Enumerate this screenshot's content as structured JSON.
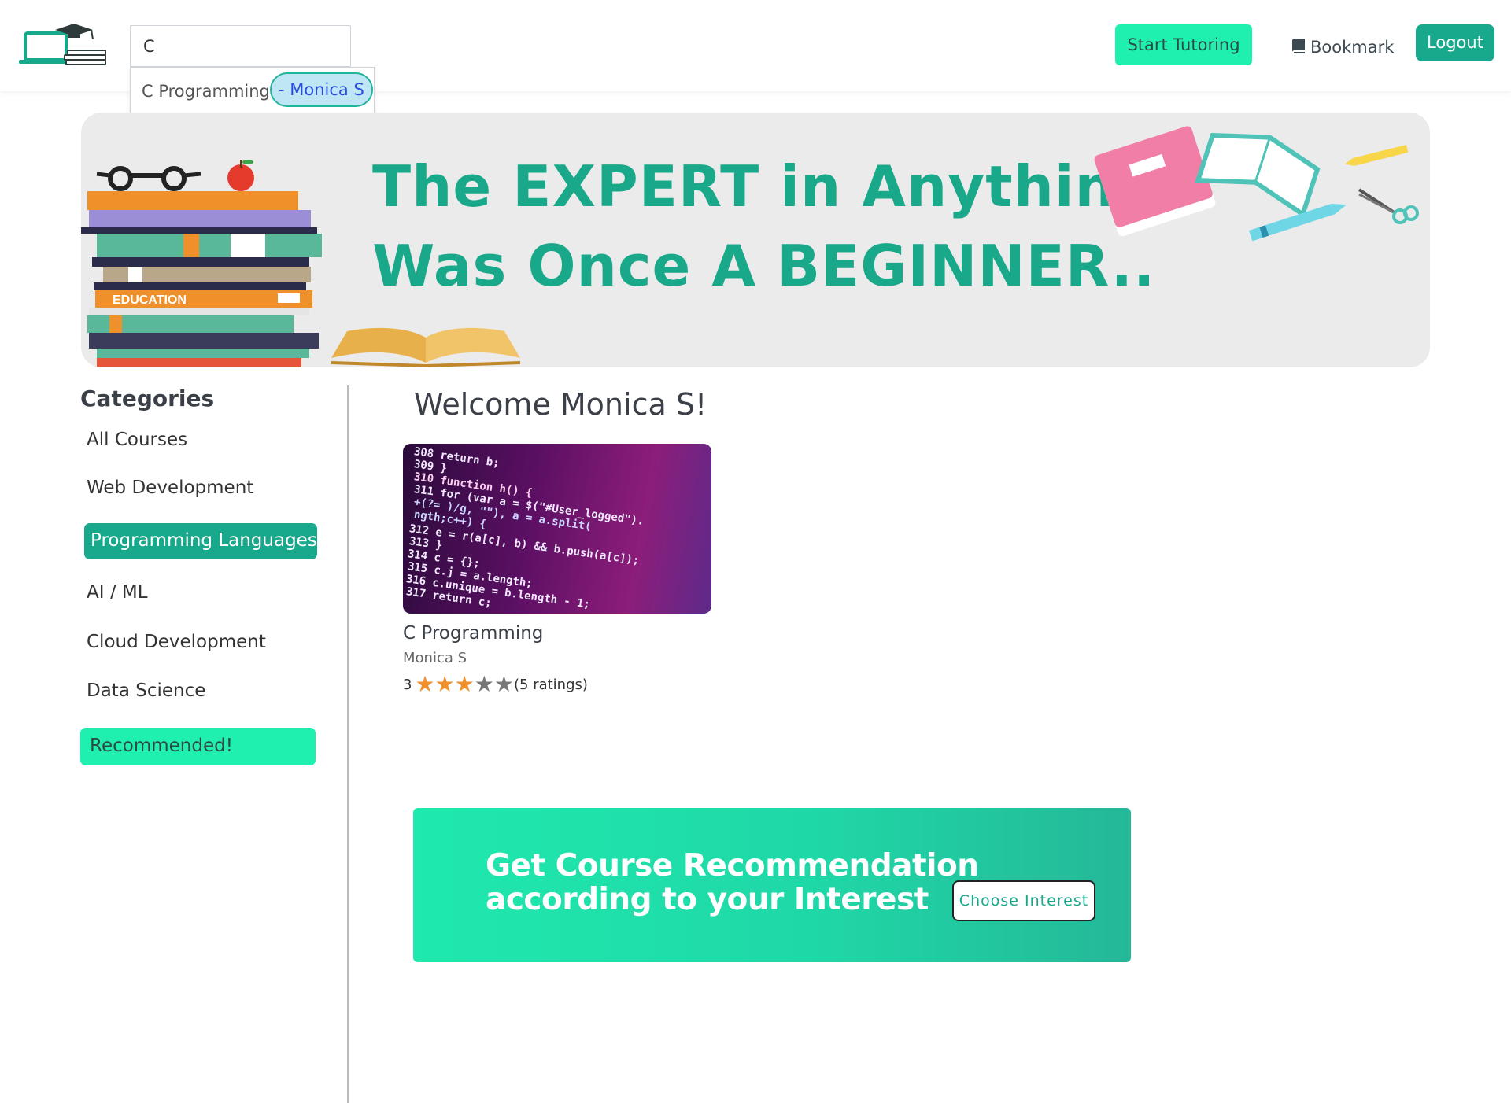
{
  "header": {
    "search_value": "C",
    "suggestion": {
      "course": "C Programming",
      "author": "- Monica S"
    },
    "start_tutoring_label": "Start Tutoring",
    "bookmark_label": "Bookmark",
    "logout_label": "Logout"
  },
  "banner": {
    "line1": "The EXPERT in Anything",
    "line2": "Was Once A BEGINNER..",
    "book_label": "EDUCATION"
  },
  "sidebar": {
    "title": "Categories",
    "items": [
      {
        "label": "All Courses"
      },
      {
        "label": "Web Development"
      },
      {
        "label": "Programming Languages",
        "active": true
      },
      {
        "label": "AI / ML"
      },
      {
        "label": "Cloud Development"
      },
      {
        "label": "Data Science"
      }
    ],
    "recommended_label": "Recommended!"
  },
  "main": {
    "welcome": "Welcome Monica S!",
    "course": {
      "title": "C Programming",
      "author": "Monica S",
      "rating": "3",
      "ratings_count": "(5 ratings)",
      "stars_filled": 3,
      "stars_total": 5,
      "thumbnail_code": [
        "308     return b;",
        "309   }",
        "310   function h() {",
        "311     for (var a = $(\"#User_logged\").",
        "          +(?= )/g, \"\"), a = a.split(",
        "          ngth;c++) {",
        "312   e = r(a[c], b) && b.push(a[c]);",
        "313   }",
        "314   c = {};",
        "315   c.j = a.length;",
        "316   c.unique = b.length - 1;",
        "317   return c;"
      ]
    },
    "recommendation": {
      "line1": "Get Course Recommendation",
      "line2": "according to your Interest",
      "button_label": "Choose Interest"
    }
  },
  "colors": {
    "teal": "#18a98c",
    "mint": "#1ff0b0",
    "star": "#f0902a"
  }
}
